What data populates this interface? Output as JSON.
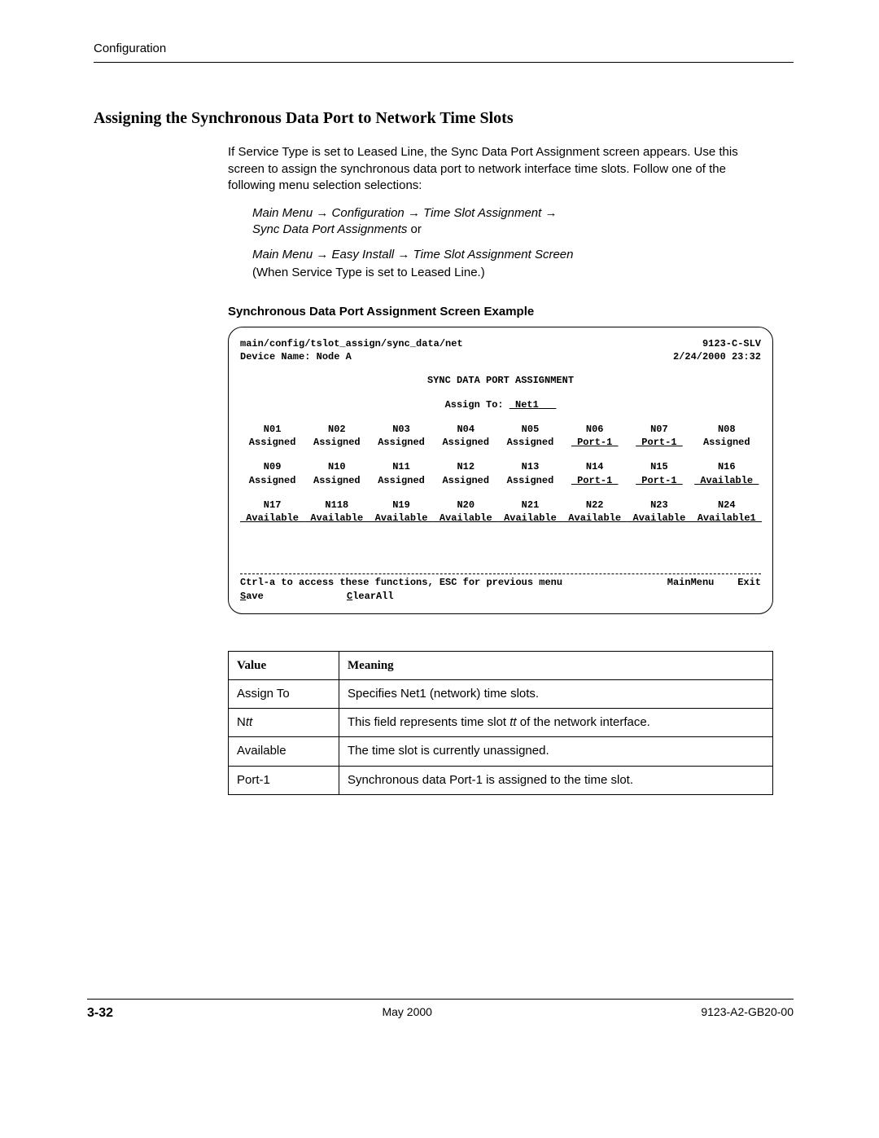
{
  "header": {
    "chapter": "Configuration"
  },
  "section": {
    "title": "Assigning the Synchronous Data Port to Network Time Slots",
    "intro": "If Service Type is set to Leased Line, the Sync Data Port Assignment screen appears. Use this screen to assign the synchronous data port to network interface time slots. Follow one of the following menu selection selections:",
    "path1_prefix": "Main Menu",
    "path1_a": "Configuration",
    "path1_b": "Time Slot Assignment",
    "path1_c": "Sync Data Port Assignments",
    "path1_suffix": " or",
    "path2_prefix": "Main Menu",
    "path2_a": "Easy Install",
    "path2_b": "Time Slot Assignment Screen",
    "path2_follow": "(When Service Type is set to Leased Line.)",
    "subhead": "Synchronous Data Port Assignment Screen Example"
  },
  "terminal": {
    "breadcrumb": "main/config/tslot_assign/sync_data/net",
    "model": "9123-C-SLV",
    "device_label": "Device Name: Node A",
    "datetime": "2/24/2000 23:32",
    "title": "SYNC DATA PORT ASSIGNMENT",
    "assign_label": "Assign To:",
    "assign_value": "Net1",
    "slots": [
      {
        "n": "N01",
        "v": "Assigned",
        "u": false
      },
      {
        "n": "N02",
        "v": "Assigned",
        "u": false
      },
      {
        "n": "N03",
        "v": "Assigned",
        "u": false
      },
      {
        "n": "N04",
        "v": "Assigned",
        "u": false
      },
      {
        "n": "N05",
        "v": "Assigned",
        "u": false
      },
      {
        "n": "N06",
        "v": "Port-1",
        "u": true
      },
      {
        "n": "N07",
        "v": "Port-1",
        "u": true
      },
      {
        "n": "N08",
        "v": "Assigned",
        "u": false
      },
      {
        "n": "N09",
        "v": "Assigned",
        "u": false
      },
      {
        "n": "N10",
        "v": "Assigned",
        "u": false
      },
      {
        "n": "N11",
        "v": "Assigned",
        "u": false
      },
      {
        "n": "N12",
        "v": "Assigned",
        "u": false
      },
      {
        "n": "N13",
        "v": "Assigned",
        "u": false
      },
      {
        "n": "N14",
        "v": "Port-1",
        "u": true
      },
      {
        "n": "N15",
        "v": "Port-1",
        "u": true
      },
      {
        "n": "N16",
        "v": "Available",
        "u": true
      },
      {
        "n": "N17",
        "v": "Available",
        "u": true
      },
      {
        "n": "N118",
        "v": "Available",
        "u": true
      },
      {
        "n": "N19",
        "v": "Available",
        "u": true
      },
      {
        "n": "N20",
        "v": "Available",
        "u": true
      },
      {
        "n": "N21",
        "v": "Available",
        "u": true
      },
      {
        "n": "N22",
        "v": "Available",
        "u": true
      },
      {
        "n": "N23",
        "v": "Available",
        "u": true
      },
      {
        "n": "N24",
        "v": "Available1",
        "u": true
      }
    ],
    "hint": "Ctrl-a to access these functions, ESC for previous menu",
    "mainmenu": "MainMenu",
    "exit": "Exit",
    "save_u": "S",
    "save_rest": "ave",
    "clear_u": "C",
    "clear_rest": "learAll"
  },
  "table": {
    "head_value": "Value",
    "head_meaning": "Meaning",
    "rows": [
      {
        "v": "Assign To",
        "m": "Specifies Net1 (network) time slots."
      },
      {
        "v_pre": "N",
        "v_it": "tt",
        "m_pre": "This field represents time slot ",
        "m_it": "tt",
        "m_post": " of the network interface."
      },
      {
        "v": "Available",
        "m": "The time slot is currently unassigned."
      },
      {
        "v": "Port-1",
        "m": "Synchronous data Port-1 is assigned to the time slot."
      }
    ]
  },
  "footer": {
    "page": "3-32",
    "date": "May 2000",
    "doc": "9123-A2-GB20-00"
  }
}
